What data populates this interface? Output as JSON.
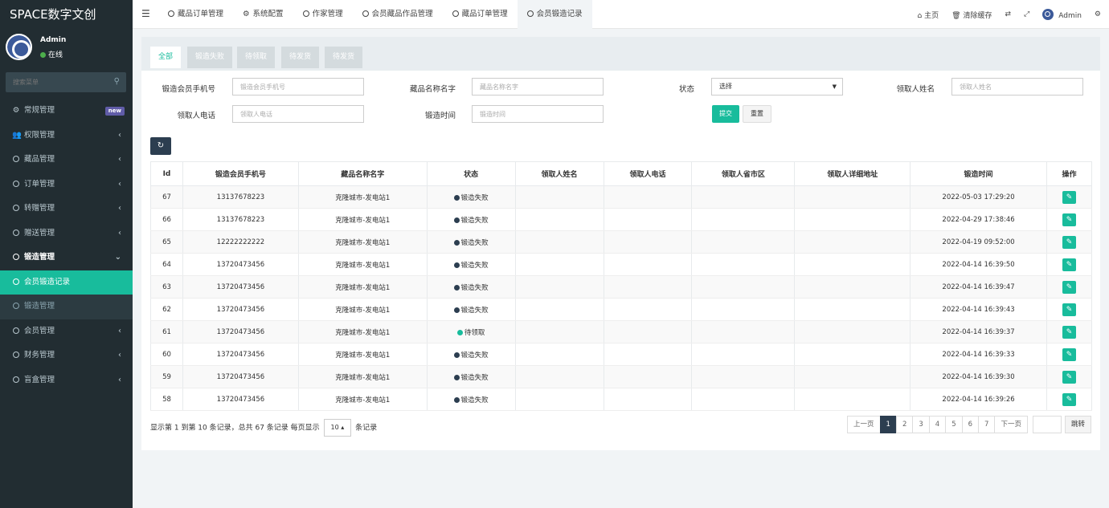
{
  "sidebar": {
    "brand": "SPACE数字文创",
    "user": {
      "name": "Admin",
      "status": "在线"
    },
    "search_placeholder": "搜索菜单",
    "items": [
      {
        "label": "常规管理",
        "icon": "cogs-icon",
        "badge": "new"
      },
      {
        "label": "权限管理",
        "icon": "users-icon",
        "arrow": "‹"
      },
      {
        "label": "藏品管理",
        "icon": "circle-icon",
        "arrow": "‹"
      },
      {
        "label": "订单管理",
        "icon": "circle-icon",
        "arrow": "‹"
      },
      {
        "label": "转赠管理",
        "icon": "circle-icon",
        "arrow": "‹"
      },
      {
        "label": "赠送管理",
        "icon": "circle-icon",
        "arrow": "‹"
      },
      {
        "label": "锻造管理",
        "icon": "circle-icon",
        "arrow": "⌄"
      },
      {
        "label": "会员锻造记录",
        "icon": "circle-icon"
      },
      {
        "label": "锻造管理",
        "icon": "circle-icon"
      },
      {
        "label": "会员管理",
        "icon": "circle-icon",
        "arrow": "‹"
      },
      {
        "label": "财务管理",
        "icon": "circle-icon",
        "arrow": "‹"
      },
      {
        "label": "盲盒管理",
        "icon": "circle-icon",
        "arrow": "‹"
      }
    ]
  },
  "topbar": {
    "tabs": [
      "藏品订单管理",
      "系统配置",
      "作家管理",
      "会员藏品作品管理",
      "藏品订单管理",
      "会员锻造记录"
    ],
    "right": {
      "home": "主页",
      "clear_cache": "清除缓存",
      "user": "Admin"
    }
  },
  "filter_tabs": [
    "全部",
    "锻造失败",
    "待领取",
    "待发货",
    "待发货"
  ],
  "form": {
    "phone": {
      "label": "锻造会员手机号",
      "placeholder": "锻造会员手机号"
    },
    "name": {
      "label": "藏品名称名字",
      "placeholder": "藏品名称名字"
    },
    "status": {
      "label": "状态",
      "value": "选择"
    },
    "receiver_name": {
      "label": "领取人姓名",
      "placeholder": "领取人姓名"
    },
    "receiver_phone": {
      "label": "领取人电话",
      "placeholder": "领取人电话"
    },
    "time": {
      "label": "锻造时间",
      "placeholder": "锻造时间"
    },
    "submit": "提交",
    "reset": "重置"
  },
  "table": {
    "columns": [
      "Id",
      "锻造会员手机号",
      "藏品名称名字",
      "状态",
      "领取人姓名",
      "领取人电话",
      "领取人省市区",
      "领取人详细地址",
      "锻造时间",
      "操作"
    ],
    "rows": [
      {
        "id": "67",
        "phone": "13137678223",
        "name": "克隆城市-发电站1",
        "status": "锻造失败",
        "time": "2022-05-03 17:29:20"
      },
      {
        "id": "66",
        "phone": "13137678223",
        "name": "克隆城市-发电站1",
        "status": "锻造失败",
        "time": "2022-04-29 17:38:46"
      },
      {
        "id": "65",
        "phone": "12222222222",
        "name": "克隆城市-发电站1",
        "status": "锻造失败",
        "time": "2022-04-19 09:52:00"
      },
      {
        "id": "64",
        "phone": "13720473456",
        "name": "克隆城市-发电站1",
        "status": "锻造失败",
        "time": "2022-04-14 16:39:50"
      },
      {
        "id": "63",
        "phone": "13720473456",
        "name": "克隆城市-发电站1",
        "status": "锻造失败",
        "time": "2022-04-14 16:39:47"
      },
      {
        "id": "62",
        "phone": "13720473456",
        "name": "克隆城市-发电站1",
        "status": "锻造失败",
        "time": "2022-04-14 16:39:43"
      },
      {
        "id": "61",
        "phone": "13720473456",
        "name": "克隆城市-发电站1",
        "status": "待领取",
        "time": "2022-04-14 16:39:37"
      },
      {
        "id": "60",
        "phone": "13720473456",
        "name": "克隆城市-发电站1",
        "status": "锻造失败",
        "time": "2022-04-14 16:39:33"
      },
      {
        "id": "59",
        "phone": "13720473456",
        "name": "克隆城市-发电站1",
        "status": "锻造失败",
        "time": "2022-04-14 16:39:30"
      },
      {
        "id": "58",
        "phone": "13720473456",
        "name": "克隆城市-发电站1",
        "status": "锻造失败",
        "time": "2022-04-14 16:39:26"
      }
    ]
  },
  "pager": {
    "info_prefix": "显示第 1 到第 10 条记录，总共 67 条记录 每页显示",
    "page_size": "10",
    "info_suffix": "条记录",
    "prev": "上一页",
    "pages": [
      "1",
      "2",
      "3",
      "4",
      "5",
      "6",
      "7"
    ],
    "next": "下一页",
    "jump": "跳转"
  },
  "colors": {
    "accent": "#18bc9c",
    "sidebar_bg": "#222d32",
    "dark": "#2c3e50",
    "badge": "#605ca8"
  }
}
